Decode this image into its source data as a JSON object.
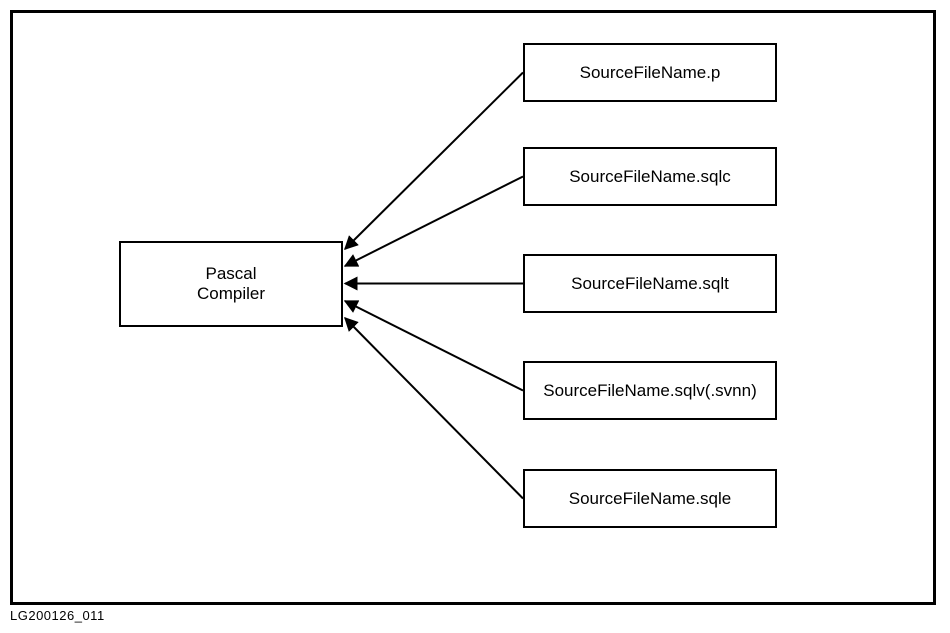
{
  "diagram": {
    "caption": "LG200126_011",
    "target": {
      "line1": "Pascal",
      "line2": "Compiler"
    },
    "sources": [
      {
        "label": "SourceFileName.p"
      },
      {
        "label": "SourceFileName.sqlc"
      },
      {
        "label": "SourceFileName.sqlt"
      },
      {
        "label": "SourceFileName.sqlv(.svnn)"
      },
      {
        "label": "SourceFileName.sqle"
      }
    ]
  }
}
